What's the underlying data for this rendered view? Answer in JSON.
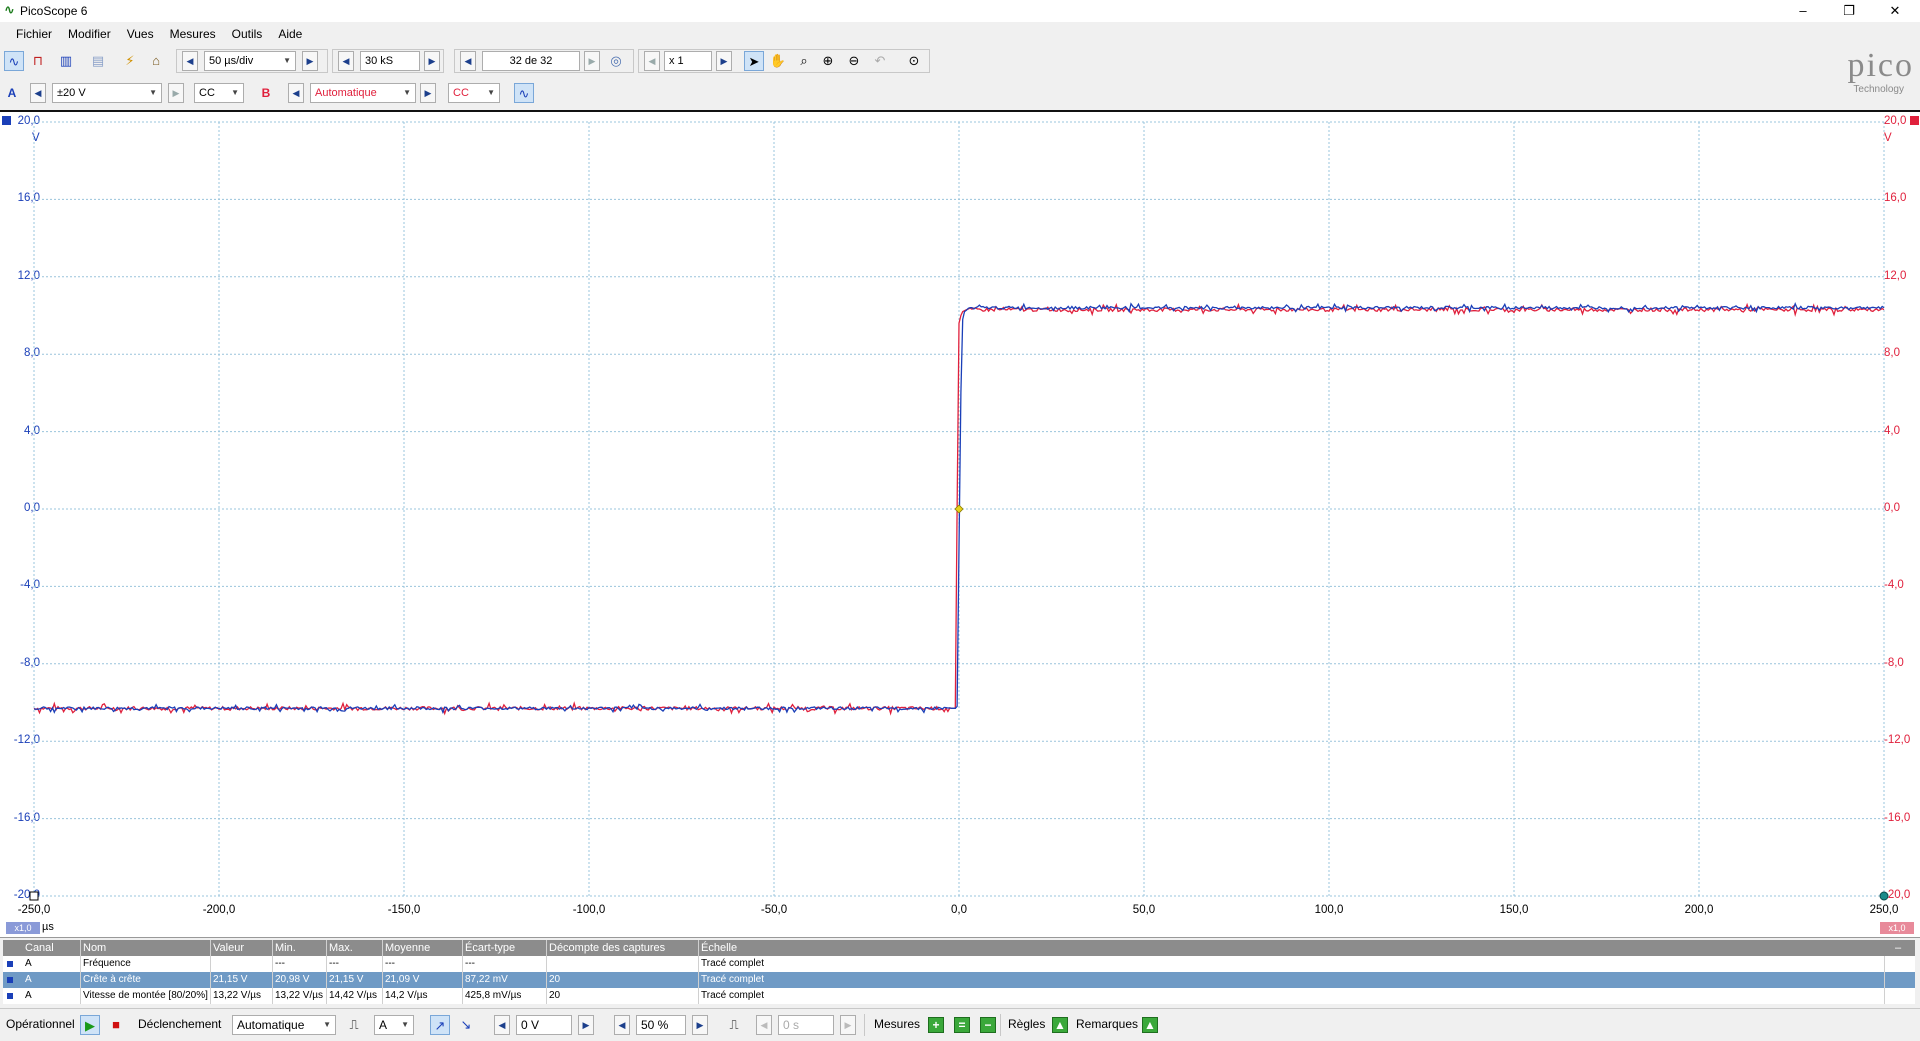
{
  "window": {
    "title": "PicoScope 6",
    "min": "–",
    "max": "❐",
    "close": "✕"
  },
  "menu": [
    "Fichier",
    "Modifier",
    "Vues",
    "Mesures",
    "Outils",
    "Aide"
  ],
  "toolbar1": {
    "timebase": "50 µs/div",
    "samples": "30 kS",
    "capture": "32 de 32",
    "zoom": "x 1"
  },
  "toolbar2": {
    "chA_label": "A",
    "chA_range": "±20 V",
    "chA_coupling": "CC",
    "chB_label": "B",
    "chB_range": "Automatique",
    "chB_coupling": "CC"
  },
  "logo": {
    "brand": "pico",
    "sub": "Technology"
  },
  "scope": {
    "y_left_ticks": [
      "20,0",
      "16,0",
      "12,0",
      "8,0",
      "4,0",
      "0,0",
      "-4,0",
      "-8,0",
      "-12,0",
      "-16,0",
      "-20,0"
    ],
    "y_right_ticks": [
      "20,0",
      "16,0",
      "12,0",
      "8,0",
      "4,0",
      "0,0",
      "-4,0",
      "-8,0",
      "-12,0",
      "-16,0",
      "-20,0"
    ],
    "y_left_unit": "V",
    "y_right_unit": "V",
    "x_ticks": [
      "-250,0",
      "-200,0",
      "-150,0",
      "-100,0",
      "-50,0",
      "0,0",
      "50,0",
      "100,0",
      "150,0",
      "200,0",
      "250,0"
    ],
    "x_unit": "µs",
    "scale_left": "x1,0",
    "scale_right": "x1,0",
    "colors": {
      "chA": "#1a3fb8",
      "chB": "#e0203c",
      "grid": "#9ac4dc",
      "trigger": "#e8d21a"
    }
  },
  "chart_data": {
    "type": "line",
    "xlabel": "µs",
    "ylabel": "V",
    "xlim": [
      -250,
      250
    ],
    "ylim": [
      -20,
      20
    ],
    "grid": true,
    "series": [
      {
        "name": "A",
        "x": [
          -250,
          -1,
          -0.5,
          0,
          0.5,
          1,
          1.5,
          3,
          250
        ],
        "values": [
          -10.3,
          -10.3,
          -10.2,
          -2,
          6,
          9.8,
          10.2,
          10.4,
          10.4
        ]
      },
      {
        "name": "B",
        "x": [
          -250,
          -1,
          -0.5,
          0,
          0.5,
          1,
          2,
          250
        ],
        "values": [
          -10.3,
          -10.3,
          0,
          9.6,
          10.0,
          10.2,
          10.3,
          10.3
        ]
      }
    ],
    "trigger": {
      "x": 0,
      "y": 0
    }
  },
  "measurements": {
    "headers": [
      "Canal",
      "Nom",
      "Valeur",
      "Min.",
      "Max.",
      "Moyenne",
      "Écart-type",
      "Décompte des captures",
      "Échelle"
    ],
    "rows": [
      [
        "A",
        "Fréquence",
        "",
        "---",
        "---",
        "---",
        "---",
        "",
        "Tracé complet"
      ],
      [
        "A",
        "Crête à crête",
        "21,15 V",
        "20,98 V",
        "21,15 V",
        "21,09 V",
        "87,22 mV",
        "20",
        "Tracé complet"
      ],
      [
        "A",
        "Vitesse de montée  [80/20%]",
        "13,22 V/µs",
        "13,22 V/µs",
        "14,42 V/µs",
        "14,2 V/µs",
        "425,8 mV/µs",
        "20",
        "Tracé complet"
      ]
    ],
    "collapse": "–"
  },
  "statusbar": {
    "mode": "Opérationnel",
    "trigger_label": "Déclenchement",
    "trigger_mode": "Automatique",
    "trigger_channel": "A",
    "trigger_level": "0 V",
    "pretrigger": "50 %",
    "delay": "0 s",
    "measures": "Mesures",
    "rules": "Règles",
    "notes": "Remarques"
  }
}
